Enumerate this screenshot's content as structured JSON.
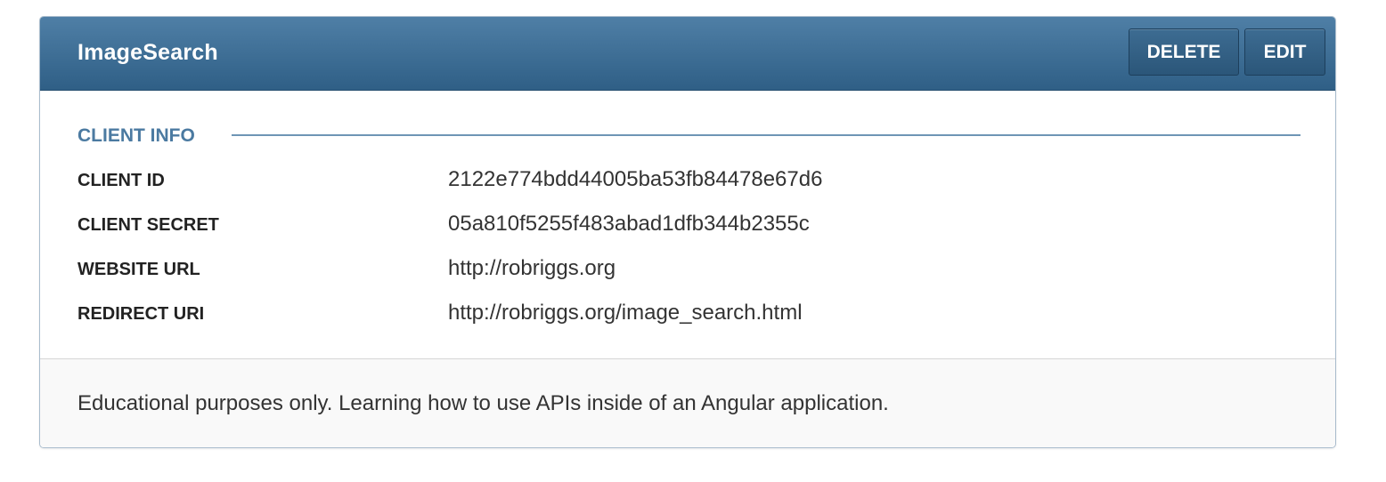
{
  "app": {
    "name": "ImageSearch"
  },
  "actions": {
    "delete_label": "DELETE",
    "edit_label": "EDIT"
  },
  "client_info": {
    "section_title": "CLIENT INFO",
    "rows": [
      {
        "label": "CLIENT ID",
        "value": "2122e774bdd44005ba53fb84478e67d6"
      },
      {
        "label": "CLIENT SECRET",
        "value": "05a810f5255f483abad1dfb344b2355c"
      },
      {
        "label": "WEBSITE URL",
        "value": "http://robriggs.org"
      },
      {
        "label": "REDIRECT URI",
        "value": "http://robriggs.org/image_search.html"
      }
    ]
  },
  "description": "Educational purposes only. Learning how to use APIs inside of an Angular application.",
  "colors": {
    "header": "#3d6c92",
    "section_accent": "#4b7aa1"
  }
}
